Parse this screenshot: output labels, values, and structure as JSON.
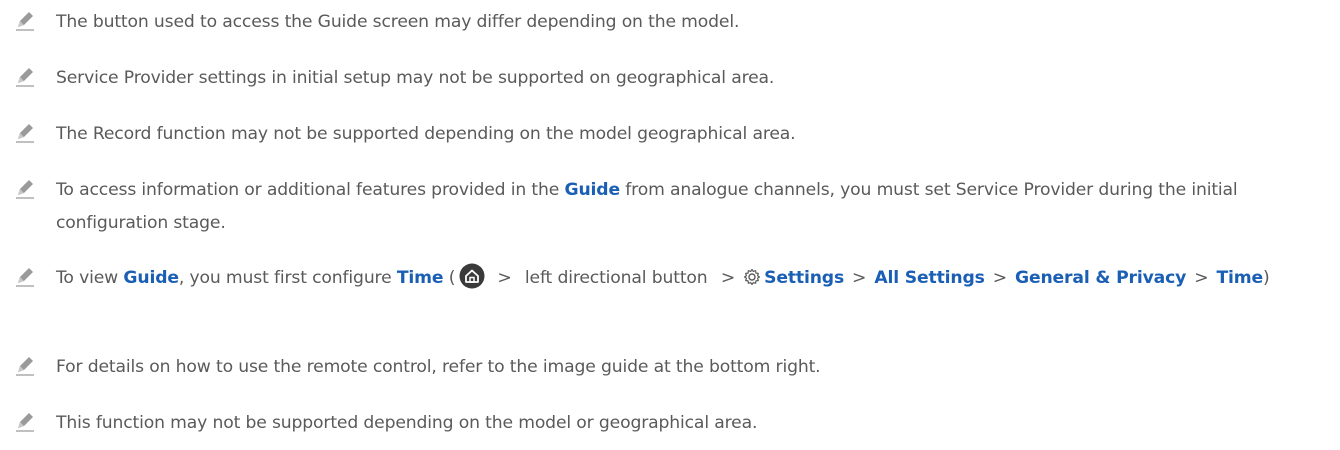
{
  "notes": {
    "n1": {
      "text": "The button used to access the Guide screen may differ depending on the model."
    },
    "n2": {
      "text": "Service Provider settings in initial setup may not be supported on geographical area."
    },
    "n3": {
      "text": "The Record function may not be supported depending on the model geographical area."
    },
    "n4": {
      "t1": "To access information or additional features provided in the ",
      "guide": "Guide",
      "t2": " from analogue channels, you must set Service Provider during the initial configuration stage."
    },
    "n5": {
      "t1": "To view ",
      "guide": "Guide",
      "t2": ", you must first configure ",
      "time": "Time",
      "paren_open": " (",
      "sep": ">",
      "left_button": " left directional button ",
      "settings": "Settings",
      "all_settings": "All Settings",
      "general_privacy": "General & Privacy",
      "time2": "Time",
      "paren_close": ")"
    },
    "n6": {
      "text": "For details on how to use the remote control, refer to the image guide at the bottom right."
    },
    "n7": {
      "text": "This function may not be supported depending on the model or geographical area."
    }
  },
  "icons": {
    "note": "pencil-icon",
    "home": "home-icon",
    "settings": "gear-icon"
  },
  "colors": {
    "text": "#5a5a5a",
    "highlight": "#1b5fb5",
    "icon": "#9a9a9a",
    "home_circle": "#3a3a3a"
  }
}
